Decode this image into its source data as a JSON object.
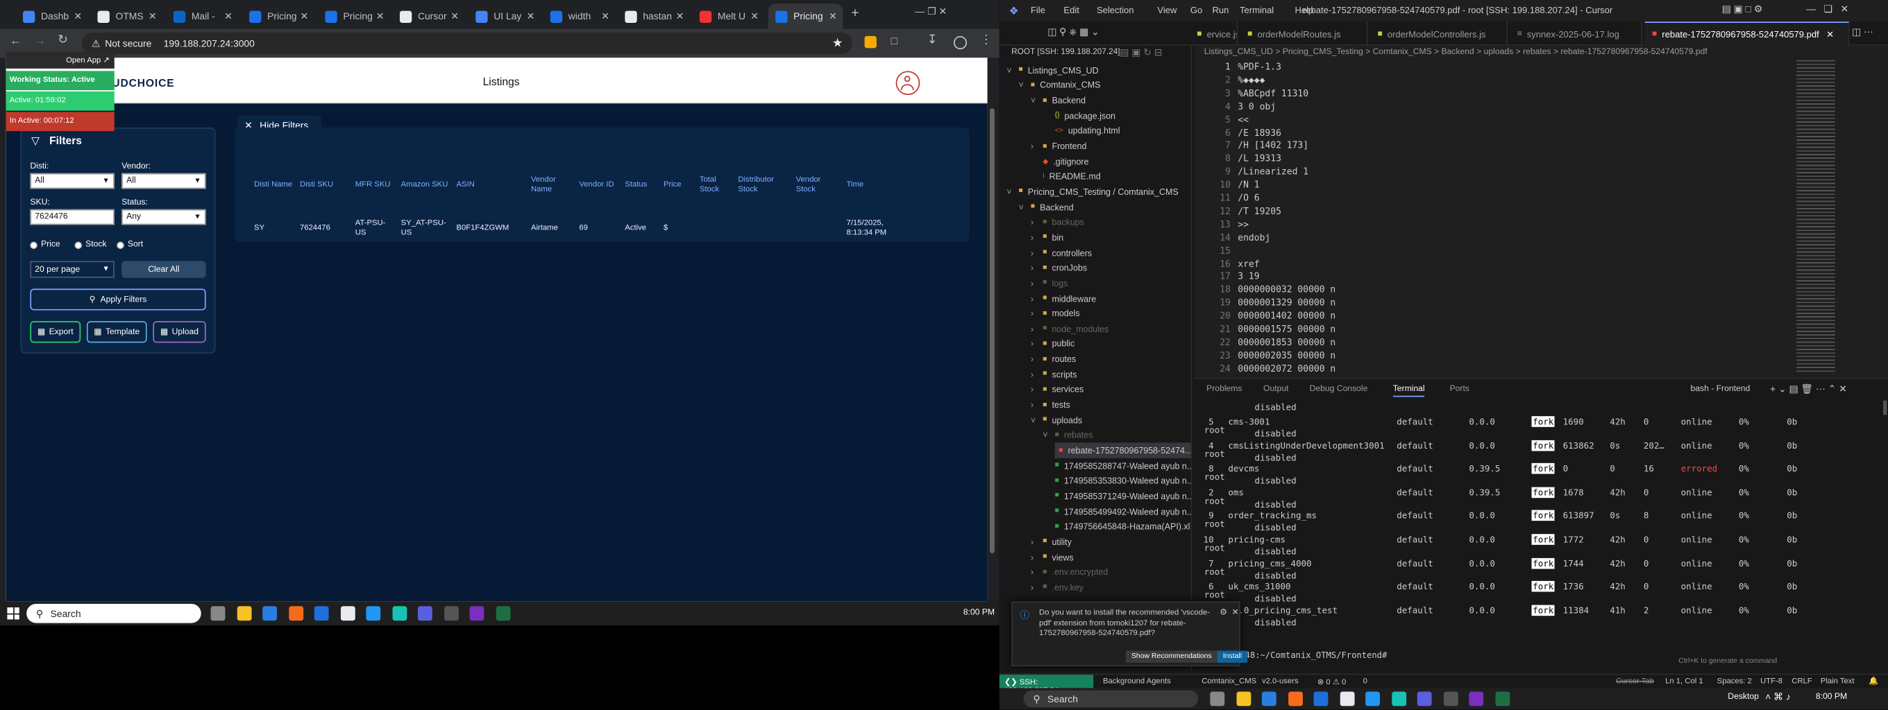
{
  "browser": {
    "tabs": [
      {
        "label": "Dashb",
        "color": "#4285f4"
      },
      {
        "label": "OTMS",
        "color": "#e8eaed"
      },
      {
        "label": "Mail -",
        "color": "#0a66c2"
      },
      {
        "label": "Pricing",
        "color": "#1a73e8"
      },
      {
        "label": "Pricing",
        "color": "#1a73e8"
      },
      {
        "label": "Cursor",
        "color": "#e8eaed"
      },
      {
        "label": "UI Lay",
        "color": "#4285f4"
      },
      {
        "label": "width",
        "color": "#1a73e8"
      },
      {
        "label": "hastan",
        "color": "#e8eaed"
      },
      {
        "label": "Melt U",
        "color": "#e33"
      },
      {
        "label": "Pricing",
        "color": "#1a73e8"
      }
    ],
    "not_secure": "Not secure",
    "url": "199.188.207.24:3000"
  },
  "status_widget": {
    "open_app": "Open App ↗",
    "working": "Working Status: Active",
    "active": "Active: 01:59:02",
    "inactive": "In Active: 00:07:12"
  },
  "app": {
    "logo": "UDCHOICE",
    "title": "Listings",
    "hide_filters": "Hide Filters",
    "filters_title": "Filters",
    "disti_label": "Disti:",
    "disti_value": "All",
    "vendor_label": "Vendor:",
    "vendor_value": "All",
    "sku_label": "SKU:",
    "sku_value": "7624476",
    "status_label": "Status:",
    "status_value": "Any",
    "radio_price": "Price",
    "radio_stock": "Stock",
    "radio_sort": "Sort",
    "per_page": "20 per page",
    "clear_all": "Clear All",
    "apply": "Apply Filters",
    "export": "Export",
    "template": "Template",
    "upload": "Upload",
    "columns": [
      "Disti Name",
      "Disti SKU",
      "MFR SKU",
      "Amazon SKU",
      "ASIN",
      "Vendor Name",
      "Vendor ID",
      "Status",
      "Price",
      "Total Stock",
      "Distributor Stock",
      "Vendor Stock",
      "Time"
    ],
    "row": [
      "SY",
      "7624476",
      "AT-PSU-US",
      "SY_AT-PSU-US",
      "B0F1F4ZGWM",
      "Airtame",
      "69",
      "Active",
      "$",
      "",
      "",
      "",
      "7/15/2025, 8:13:34 PM"
    ]
  },
  "taskbar": {
    "search": "Search",
    "time": "8:00 PM",
    "desktop": "Desktop"
  },
  "vscode": {
    "menus": [
      "File",
      "Edit",
      "Selection",
      "View",
      "Go",
      "Run",
      "Terminal",
      "Help"
    ],
    "title": "rebate-1752780967958-524740579.pdf - root [SSH: 199.188.207.24] - Cursor",
    "tabs": [
      "ervice.js",
      "orderModelRoutes.js",
      "orderModelControllers.js",
      "synnex-2025-06-17.log",
      "rebate-1752780967958-524740579.pdf"
    ],
    "root_label": "ROOT [SSH: 199.188.207.24]",
    "breadcrumb": "Listings_CMS_UD > Pricing_CMS_Testing > Comtanix_CMS > Backend > uploads > rebates > rebate-1752780967958-524740579.pdf",
    "tree": [
      {
        "label": "Listings_CMS_UD",
        "indent": 0,
        "type": "open"
      },
      {
        "label": "Comtanix_CMS",
        "indent": 1,
        "type": "open"
      },
      {
        "label": "Backend",
        "indent": 2,
        "type": "open"
      },
      {
        "label": "package.json",
        "indent": 3,
        "type": "json"
      },
      {
        "label": "updating.html",
        "indent": 3,
        "type": "html"
      },
      {
        "label": "Frontend",
        "indent": 2,
        "type": "closed"
      },
      {
        "label": ".gitignore",
        "indent": 2,
        "type": "git"
      },
      {
        "label": "README.md",
        "indent": 2,
        "type": "md"
      },
      {
        "label": "Pricing_CMS_Testing / Comtanix_CMS",
        "indent": 0,
        "type": "open"
      },
      {
        "label": "Backend",
        "indent": 1,
        "type": "open"
      },
      {
        "label": "backups",
        "indent": 2,
        "type": "dim"
      },
      {
        "label": "bin",
        "indent": 2,
        "type": "closed"
      },
      {
        "label": "controllers",
        "indent": 2,
        "type": "closed"
      },
      {
        "label": "cronJobs",
        "indent": 2,
        "type": "closed"
      },
      {
        "label": "logs",
        "indent": 2,
        "type": "dim"
      },
      {
        "label": "middleware",
        "indent": 2,
        "type": "closed"
      },
      {
        "label": "models",
        "indent": 2,
        "type": "closed"
      },
      {
        "label": "node_modules",
        "indent": 2,
        "type": "dim"
      },
      {
        "label": "public",
        "indent": 2,
        "type": "closed"
      },
      {
        "label": "routes",
        "indent": 2,
        "type": "closed"
      },
      {
        "label": "scripts",
        "indent": 2,
        "type": "closed"
      },
      {
        "label": "services",
        "indent": 2,
        "type": "closed"
      },
      {
        "label": "tests",
        "indent": 2,
        "type": "closed"
      },
      {
        "label": "uploads",
        "indent": 2,
        "type": "open"
      },
      {
        "label": "rebates",
        "indent": 3,
        "type": "dimopen"
      },
      {
        "label": "rebate-1752780967958-52474...",
        "indent": 4,
        "type": "pdf"
      },
      {
        "label": "1749585288747-Waleed ayub n...",
        "indent": 3,
        "type": "xls"
      },
      {
        "label": "1749585353830-Waleed ayub n...",
        "indent": 3,
        "type": "xls"
      },
      {
        "label": "1749585371249-Waleed ayub n...",
        "indent": 3,
        "type": "xls"
      },
      {
        "label": "1749585499492-Waleed ayub n...",
        "indent": 3,
        "type": "xls"
      },
      {
        "label": "1749756645848-Hazama(API).xl...",
        "indent": 3,
        "type": "xls"
      },
      {
        "label": "utility",
        "indent": 2,
        "type": "closed"
      },
      {
        "label": "views",
        "indent": 2,
        "type": "closed"
      },
      {
        "label": ".env.encrypted",
        "indent": 2,
        "type": "dim"
      },
      {
        "label": ".env.key",
        "indent": 2,
        "type": "dim"
      }
    ],
    "code": [
      "%PDF-1.3",
      "%◆◆◆◆",
      "%ABCpdf 11310",
      "3 0 obj",
      "<<",
      "/E 18936",
      "/H [1402 173]",
      "/L 19313",
      "/Linearized 1",
      "/N 1",
      "/O 6",
      "/T 19205",
      ">>",
      "endobj",
      "",
      "xref",
      "3 19",
      "0000000032 00000 n",
      "0000001329 00000 n",
      "0000001402 00000 n",
      "0000001575 00000 n",
      "0000001853 00000 n",
      "0000002035 00000 n",
      "0000002072 00000 n"
    ],
    "panel_tabs": [
      "Problems",
      "Output",
      "Debug Console",
      "Terminal",
      "Ports"
    ],
    "bash_label": "bash - Frontend",
    "processes": [
      {
        "id": "5",
        "name": "cms-3001",
        "ns": "default",
        "ver": "0.0.0",
        "mode": "fork",
        "pid": "1690",
        "up": "42h",
        "restarts": "0",
        "status": "online",
        "cpu": "0%",
        "mem": "0b"
      },
      {
        "id": "4",
        "name": "cmsListingUnderDevelopment3001",
        "ns": "default",
        "ver": "0.0.0",
        "mode": "fork",
        "pid": "613862",
        "up": "0s",
        "restarts": "202…",
        "status": "online",
        "cpu": "0%",
        "mem": "0b"
      },
      {
        "id": "8",
        "name": "devcms",
        "ns": "default",
        "ver": "0.39.5",
        "mode": "fork",
        "pid": "0",
        "up": "0",
        "restarts": "16",
        "status": "errored",
        "cpu": "0%",
        "mem": "0b"
      },
      {
        "id": "2",
        "name": "oms",
        "ns": "default",
        "ver": "0.39.5",
        "mode": "fork",
        "pid": "1678",
        "up": "42h",
        "restarts": "0",
        "status": "online",
        "cpu": "0%",
        "mem": "0b"
      },
      {
        "id": "9",
        "name": "order_tracking_ms",
        "ns": "default",
        "ver": "0.0.0",
        "mode": "fork",
        "pid": "613897",
        "up": "0s",
        "restarts": "8",
        "status": "online",
        "cpu": "0%",
        "mem": "0b"
      },
      {
        "id": "10",
        "name": "pricing-cms",
        "ns": "default",
        "ver": "0.0.0",
        "mode": "fork",
        "pid": "1772",
        "up": "42h",
        "restarts": "0",
        "status": "online",
        "cpu": "0%",
        "mem": "0b"
      },
      {
        "id": "7",
        "name": "pricing_cms_4000",
        "ns": "default",
        "ver": "0.0.0",
        "mode": "fork",
        "pid": "1744",
        "up": "42h",
        "restarts": "0",
        "status": "online",
        "cpu": "0%",
        "mem": "0b"
      },
      {
        "id": "6",
        "name": "uk_cms_31000",
        "ns": "default",
        "ver": "0.0.0",
        "mode": "fork",
        "pid": "1736",
        "up": "42h",
        "restarts": "0",
        "status": "online",
        "cpu": "0%",
        "mem": "0b"
      },
      {
        "id": "3",
        "name": "v3.0_pricing_cms_test",
        "ns": "default",
        "ver": "0.0.0",
        "mode": "fork",
        "pid": "11384",
        "up": "41h",
        "restarts": "2",
        "status": "online",
        "cpu": "0%",
        "mem": "0b"
      }
    ],
    "root_word": "root",
    "disabled_word": "disabled",
    "prompt": "-ph-1564-48:~/Comtanix_OTMS/Frontend# ",
    "ctrl_hint": "Ctrl+K to generate a command",
    "notif_text": "Do you want to install the recommended 'vscode-pdf' extension from tomoki1207 for rebate-1752780967958-524740579.pdf?",
    "notif_show": "Show Recommendations",
    "notif_install": "Install",
    "status": {
      "ssh": "SSH: 199.188.207.24",
      "agents": "Background Agents",
      "branch": "Comtanix_CMS",
      "users": "v2.0-users",
      "problems": "⊗ 0 ⚠ 0",
      "ports": "0",
      "ln": "Ln 1, Col 1",
      "spaces": "Spaces: 2",
      "enc": "UTF-8",
      "eol": "CRLF",
      "lang": "Plain Text",
      "cursor_tab": "Cursor Tab"
    }
  }
}
